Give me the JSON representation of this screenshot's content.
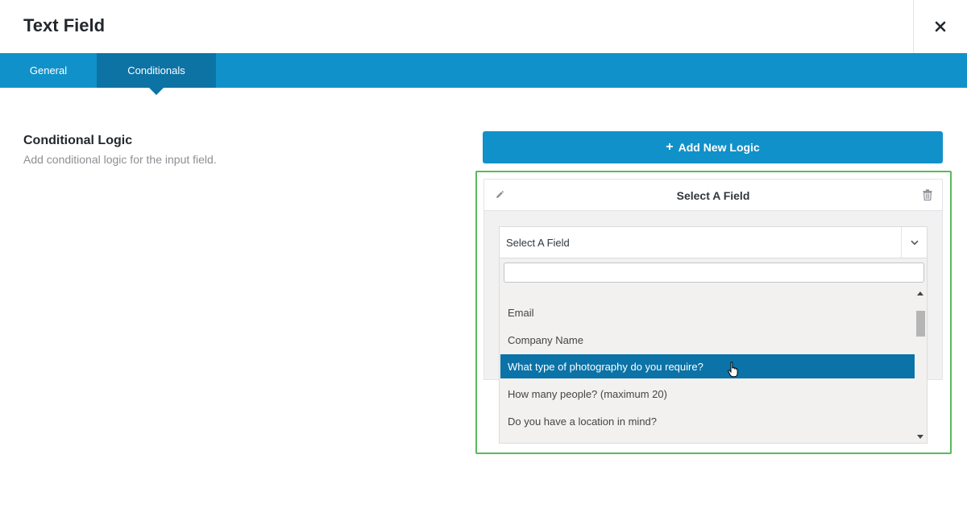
{
  "modal": {
    "title": "Text Field",
    "close_icon": "close-icon"
  },
  "tabs": [
    {
      "label": "General",
      "active": false
    },
    {
      "label": "Conditionals",
      "active": true
    }
  ],
  "section": {
    "title": "Conditional Logic",
    "description": "Add conditional logic for the input field."
  },
  "add_button": {
    "label": "Add New Logic",
    "icon": "plus-icon"
  },
  "logic_panel": {
    "header_label": "Select A Field",
    "edit_icon": "pencil-icon",
    "delete_icon": "trash-icon"
  },
  "field_select": {
    "selected": "Select A Field",
    "search_value": "",
    "options": [
      {
        "label": "Email",
        "highlighted": false
      },
      {
        "label": "Company Name",
        "highlighted": false
      },
      {
        "label": "What type of photography do you require?",
        "highlighted": true
      },
      {
        "label": "How many people? (maximum 20)",
        "highlighted": false
      },
      {
        "label": "Do you have a location in mind?",
        "highlighted": false
      }
    ]
  },
  "colors": {
    "accent": "#1191c9",
    "tab_active": "#0d73a5",
    "option_highlight": "#0b73a7",
    "highlight_border": "#5cb85c"
  }
}
